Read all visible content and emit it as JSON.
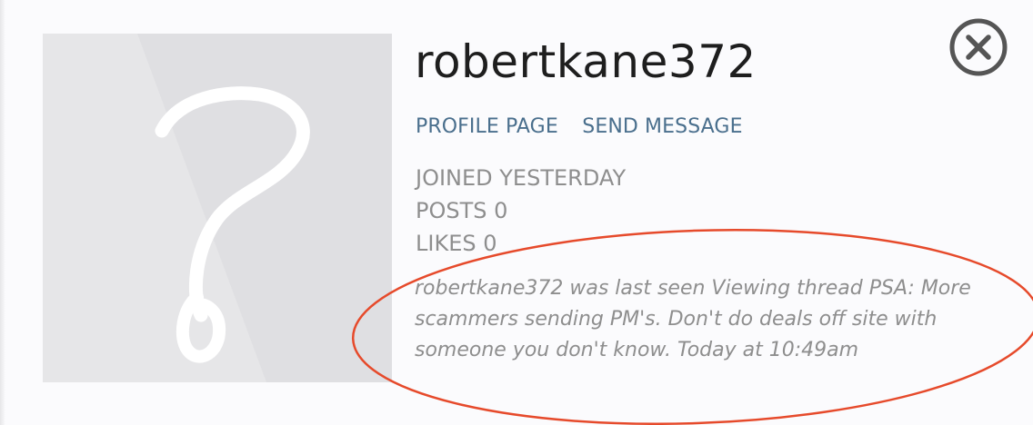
{
  "profile": {
    "username": "robertkane372",
    "avatar_icon": "question-mark-icon"
  },
  "links": {
    "profile_page": "PROFILE PAGE",
    "send_message": "SEND MESSAGE"
  },
  "stats": {
    "joined": "JOINED YESTERDAY",
    "posts": "POSTS 0",
    "likes": "LIKES 0"
  },
  "activity": {
    "last_seen": "robertkane372 was last seen Viewing thread PSA: More scammers sending PM's. Don't do deals off site with someone you don't know. Today at 10:49am"
  },
  "controls": {
    "close_icon": "close-icon"
  },
  "colors": {
    "username": "#1e1e1e",
    "link": "#4a6f8d",
    "muted_text": "#8e8e8e",
    "annotation": "#e64a2b"
  }
}
